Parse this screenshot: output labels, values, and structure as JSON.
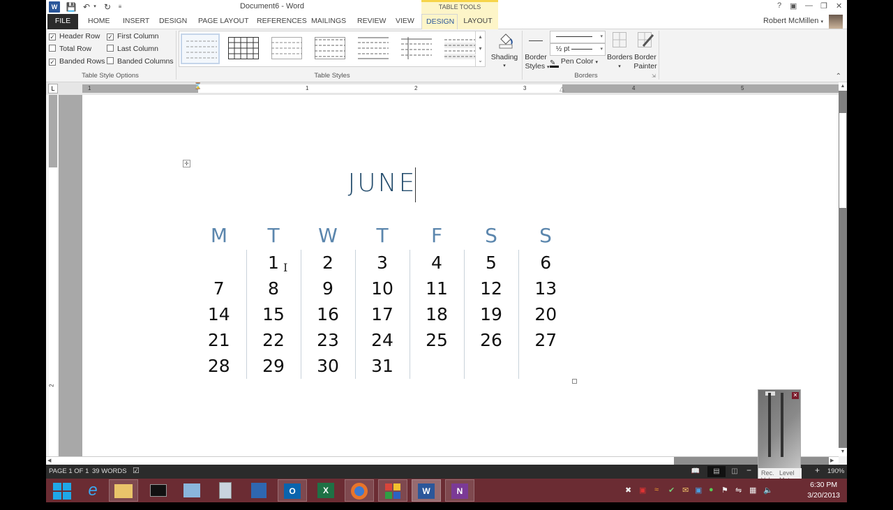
{
  "window": {
    "title": "Document6 - Word",
    "context_tab_group": "TABLE TOOLS",
    "user": "Robert McMillen",
    "controls": [
      "?",
      "ribbon-display",
      "minimize",
      "restore",
      "close"
    ]
  },
  "tabs": [
    {
      "label": "FILE"
    },
    {
      "label": "HOME"
    },
    {
      "label": "INSERT"
    },
    {
      "label": "DESIGN"
    },
    {
      "label": "PAGE LAYOUT"
    },
    {
      "label": "REFERENCES"
    },
    {
      "label": "MAILINGS"
    },
    {
      "label": "REVIEW"
    },
    {
      "label": "VIEW"
    },
    {
      "label": "DESIGN",
      "active": true,
      "contextual": true
    },
    {
      "label": "LAYOUT",
      "contextual": true
    }
  ],
  "ribbon": {
    "table_style_options": {
      "label": "Table Style Options",
      "checkboxes": [
        {
          "label": "Header Row",
          "checked": true
        },
        {
          "label": "First Column",
          "checked": true
        },
        {
          "label": "Total Row",
          "checked": false
        },
        {
          "label": "Last Column",
          "checked": false
        },
        {
          "label": "Banded Rows",
          "checked": true
        },
        {
          "label": "Banded Columns",
          "checked": false
        }
      ]
    },
    "table_styles": {
      "label": "Table Styles",
      "shading_label": "Shading"
    },
    "borders": {
      "label": "Borders",
      "border_styles_label": "Border",
      "border_styles_label2": "Styles",
      "line_weight": "½ pt",
      "pen_color_label": "Pen Color",
      "borders_label": "Borders",
      "border_painter_label": "Border",
      "border_painter_label2": "Painter"
    }
  },
  "ruler": {
    "marks": [
      "1",
      "1",
      "2",
      "3",
      "4",
      "5"
    ],
    "vertical_mark": "2"
  },
  "document": {
    "month": "JUNE",
    "weekdays": [
      "M",
      "T",
      "W",
      "T",
      "F",
      "S",
      "S"
    ],
    "weeks": [
      [
        "",
        "1",
        "2",
        "3",
        "4",
        "5",
        "6"
      ],
      [
        "7",
        "8",
        "9",
        "10",
        "11",
        "12",
        "13"
      ],
      [
        "14",
        "15",
        "16",
        "17",
        "18",
        "19",
        "20"
      ],
      [
        "21",
        "22",
        "23",
        "24",
        "25",
        "26",
        "27"
      ],
      [
        "28",
        "29",
        "30",
        "31",
        "",
        "",
        ""
      ]
    ]
  },
  "status": {
    "page": "PAGE 1 OF 1",
    "words": "39 WORDS",
    "zoom": "190%"
  },
  "level_meter": {
    "label1a": "Rec.",
    "label1b": "Vol.",
    "label2a": "Level",
    "label2b": "Meter"
  },
  "taskbar": {
    "apps": [
      "start",
      "internet-explorer",
      "file-explorer",
      "command-prompt",
      "control-panel",
      "calculator",
      "remote-desktop",
      "outlook",
      "excel",
      "firefox",
      "app-grid",
      "word",
      "onenote"
    ],
    "time": "6:30 PM",
    "date": "3/20/2013"
  }
}
